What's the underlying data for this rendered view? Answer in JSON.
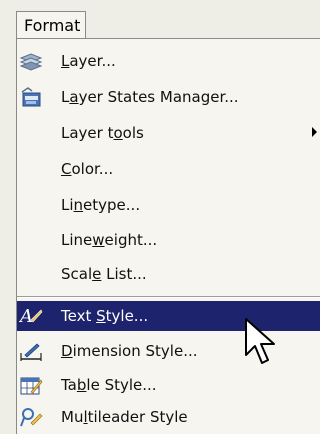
{
  "menubar": {
    "title": "Format"
  },
  "menu": {
    "items": [
      {
        "label": "Layer...",
        "icon": "layers-icon",
        "underline": "L",
        "has_submenu": false
      },
      {
        "label": "Layer States Manager...",
        "icon": "layer-states-icon",
        "underline": "a",
        "has_submenu": false
      },
      {
        "label": "Layer tools",
        "icon": "",
        "underline": "o",
        "has_submenu": true
      },
      {
        "label": "Color...",
        "icon": "",
        "underline": "C",
        "has_submenu": false
      },
      {
        "label": "Linetype...",
        "icon": "",
        "underline": "n",
        "has_submenu": false
      },
      {
        "label": "Lineweight...",
        "icon": "",
        "underline": "w",
        "has_submenu": false
      },
      {
        "label": "Scale List...",
        "icon": "",
        "underline": "e",
        "has_submenu": false
      },
      {
        "label": "Text Style...",
        "icon": "text-style-icon",
        "underline": "S",
        "has_submenu": false,
        "selected": true
      },
      {
        "label": "Dimension Style...",
        "icon": "dimension-style-icon",
        "underline": "D",
        "has_submenu": false
      },
      {
        "label": "Table Style...",
        "icon": "table-style-icon",
        "underline": "b",
        "has_submenu": false
      },
      {
        "label": "Multileader Style",
        "icon": "multileader-style-icon",
        "underline": "l",
        "has_submenu": false
      }
    ]
  },
  "colors": {
    "highlight": "#1e236e",
    "menu_bg": "#f6f5ef",
    "bar_bg": "#efeee6"
  }
}
